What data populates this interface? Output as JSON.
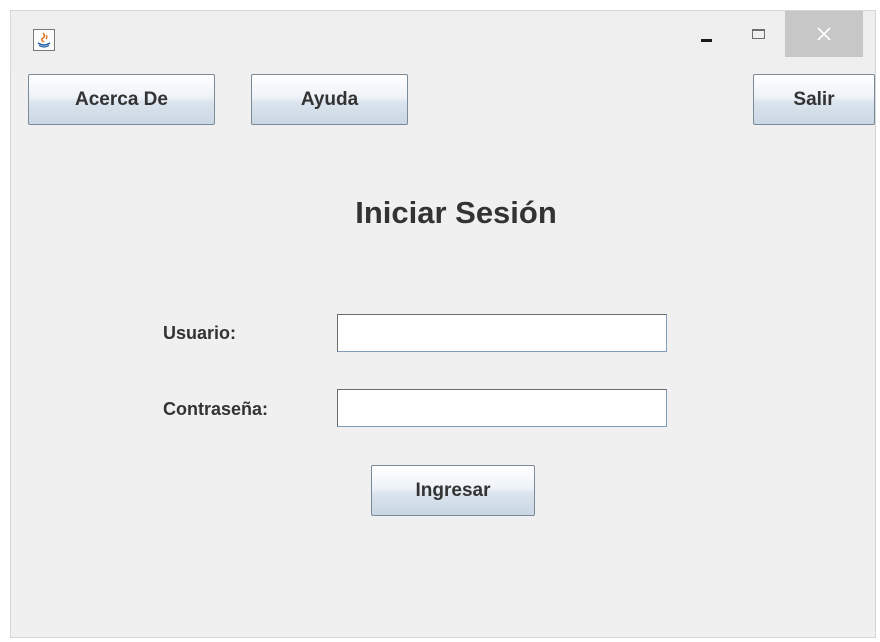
{
  "window": {
    "app_icon": "java-coffee-cup-icon",
    "controls": {
      "minimize_icon": "minimize-icon",
      "maximize_icon": "maximize-icon",
      "close_icon": "close-icon"
    }
  },
  "toolbar": {
    "about_label": "Acerca De",
    "help_label": "Ayuda",
    "exit_label": "Salir"
  },
  "login": {
    "title": "Iniciar Sesión",
    "username_label": "Usuario:",
    "username_value": "",
    "password_label": "Contraseña:",
    "password_value": "",
    "submit_label": "Ingresar"
  },
  "colors": {
    "window_background": "#f0f0f0",
    "close_button_background": "#c7c7c7",
    "text": "#333333",
    "field_border": "#7f9db9"
  }
}
